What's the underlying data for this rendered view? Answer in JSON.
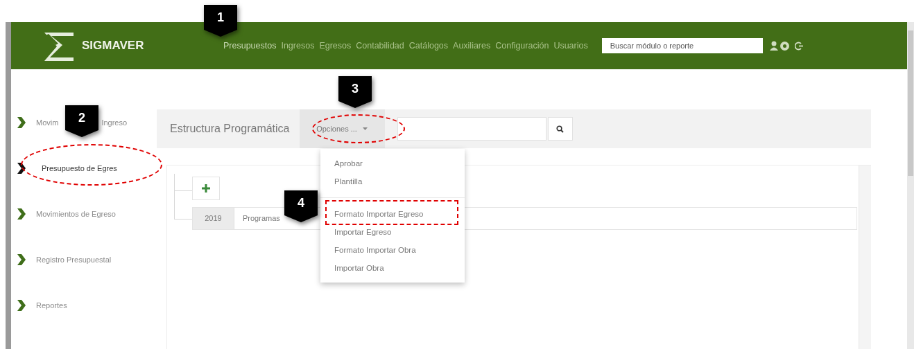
{
  "header": {
    "brand": "SIGMAVER",
    "nav": [
      {
        "label": "Presupuestos",
        "selected": true
      },
      {
        "label": "Ingresos",
        "selected": false
      },
      {
        "label": "Egresos",
        "selected": false
      },
      {
        "label": "Contabilidad",
        "selected": false
      },
      {
        "label": "Catálogos",
        "selected": false
      },
      {
        "label": "Auxiliares",
        "selected": false
      },
      {
        "label": "Configuración",
        "selected": false
      },
      {
        "label": "Usuarios",
        "selected": false
      }
    ],
    "search": {
      "placeholder": "Buscar módulo o reporte"
    }
  },
  "sidebar": {
    "items": [
      {
        "label": "Movim",
        "label_end": "Ingreso",
        "selected": false
      },
      {
        "label": "Presupuesto de Egres",
        "selected": true
      },
      {
        "label": "Movimientos de Egreso",
        "selected": false
      },
      {
        "label": "Registro Presupuestal",
        "selected": false
      },
      {
        "label": "Reportes",
        "selected": false
      }
    ]
  },
  "toolbar": {
    "title": "Estructura Programática",
    "options_button": "Opciones ..."
  },
  "menu": {
    "items": [
      {
        "label": "Aprobar",
        "kind": "item"
      },
      {
        "label": "Plantilla",
        "kind": "item"
      },
      {
        "kind": "divider"
      },
      {
        "label": "Formato Importar Egreso",
        "kind": "item"
      },
      {
        "label": "Importar Egreso",
        "kind": "item"
      },
      {
        "label": "Formato Importar Obra",
        "kind": "item"
      },
      {
        "label": "Importar Obra",
        "kind": "item"
      }
    ]
  },
  "tree": {
    "row": {
      "year": "2019",
      "label": "Programas"
    }
  },
  "callouts": [
    "1",
    "2",
    "3",
    "4"
  ]
}
